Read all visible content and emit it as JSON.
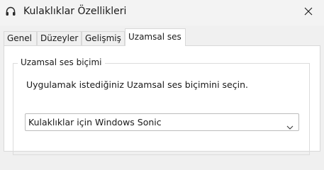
{
  "window": {
    "title": "Kulaklıklar Özellikleri"
  },
  "icons": {
    "title": "headphones-icon",
    "close": "close-icon",
    "dropdown": "chevron-down-icon"
  },
  "tabs": [
    {
      "label": "Genel",
      "active": false
    },
    {
      "label": "Düzeyler",
      "active": false
    },
    {
      "label": "Gelişmiş",
      "active": false
    },
    {
      "label": "Uzamsal ses",
      "active": true
    }
  ],
  "spatial": {
    "group_label": "Uzamsal ses biçimi",
    "description": "Uygulamak istediğiniz Uzamsal ses biçimini seçin.",
    "selected_format": "Kulaklıklar için Windows Sonic"
  },
  "colors": {
    "window_bg": "#f0f0f0",
    "panel_bg": "#ffffff",
    "border": "#d9d9d9",
    "text": "#1a1a1a"
  }
}
